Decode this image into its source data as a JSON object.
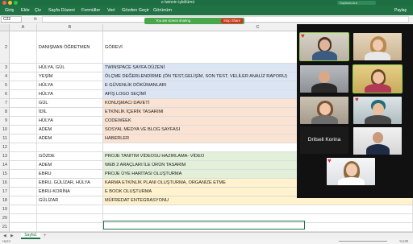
{
  "titlebar": {
    "title": "e twinnin işbölümü",
    "search_placeholder": "Sayfada Ara"
  },
  "menu": {
    "items": [
      "Giriş",
      "Ekle",
      "Çiz",
      "Sayfa Düzeni",
      "Formüller",
      "Veri",
      "Gözden Geçir",
      "Görünüm"
    ],
    "user": "Paylaş"
  },
  "formula": {
    "namebox": "C22",
    "fx": "fx"
  },
  "share": {
    "message": "You are screen sharing",
    "stop_label": "Stop Share"
  },
  "grid": {
    "columns": [
      "A",
      "B",
      "C"
    ],
    "rows": [
      {
        "num": "2",
        "b": "DANIŞMAN ÖĞRETMEN",
        "c": "GÖREVİ",
        "color": ""
      },
      {
        "num": "3",
        "b": "HÜLYA, GÜL",
        "c": " TWINSPACE SAYFA DÜZENİ",
        "color": "#dbe5f4"
      },
      {
        "num": "4",
        "b": "YEŞİM",
        "c": "ÖLÇME DEĞERLENDİRME (ÖN TEST,GELİŞİM, SON TEST, VELİLER ANALİZ RAPORU)",
        "color": "#dbe5f4"
      },
      {
        "num": "5",
        "b": "HÜLYA",
        "c": "E GÜVENLİK DÖKÜMANLARI",
        "color": "#dbe5f4"
      },
      {
        "num": "6",
        "b": "HÜLYA",
        "c": "AFİŞ LOGO SEÇİMİ",
        "color": "#dbe5f4"
      },
      {
        "num": "7",
        "b": "GÜL",
        "c": "KONUŞMACI DAVETİ",
        "color": "#fbe3d3"
      },
      {
        "num": "8",
        "b": "İDİL",
        "c": "ETKİNLİK İÇERİK TASARIMI",
        "color": "#fbe3d3"
      },
      {
        "num": "9",
        "b": "HÜLYA",
        "c": "CODEWEEK",
        "color": "#fbe3d3"
      },
      {
        "num": "10",
        "b": "ADEM",
        "c": "SOSYAL MEDYA VE BLOG SAYFASI",
        "color": "#fbe3d3"
      },
      {
        "num": "11",
        "b": "ADEM",
        "c": "HABERLER",
        "color": "#fbe3d3"
      },
      {
        "num": "12",
        "b": "",
        "c": "",
        "color": ""
      },
      {
        "num": "13",
        "b": "GÖZDE",
        "c": "PROJE TANITIM VİDEOSU HAZIRLAMA- VİDEO",
        "color": "#e2efd9"
      },
      {
        "num": "14",
        "b": "ADEM",
        "c": "WEB 2 ARAÇLARI İLE ÜRÜN TASARIM",
        "color": "#e2efd9"
      },
      {
        "num": "15",
        "b": "EBRU",
        "c": "PROJE ÜYE HARİTASI OLUŞTURMA",
        "color": "#e2efd9"
      },
      {
        "num": "16",
        "b": "EBRU, GÜLİZAR, HÜLYA",
        "c": "KARMA ETKİNLİK PLANI OLUŞTURMA, ORGANİZE ETME",
        "color": "#fff2cc"
      },
      {
        "num": "17",
        "b": "EBRU-KORİNA",
        "c": "E BOOK OLUŞTURMA",
        "color": "#fff2cc"
      },
      {
        "num": "18",
        "b": "GÜLİZAR",
        "c": "MÜFREDAT ENTEGRASYONU",
        "color": "#fff2cc"
      },
      {
        "num": "19",
        "b": "",
        "c": "",
        "color": ""
      },
      {
        "num": "20",
        "b": "",
        "c": "",
        "color": ""
      },
      {
        "num": "21",
        "b": "",
        "c": "",
        "color": ""
      },
      {
        "num": "22",
        "b": "",
        "c": "",
        "color": ""
      }
    ]
  },
  "sheets": {
    "active": "Sayfa1",
    "status_left": "Hazır",
    "zoom": "%139"
  },
  "zoom_meeting": {
    "named_participant": "Dritseli Korina"
  }
}
